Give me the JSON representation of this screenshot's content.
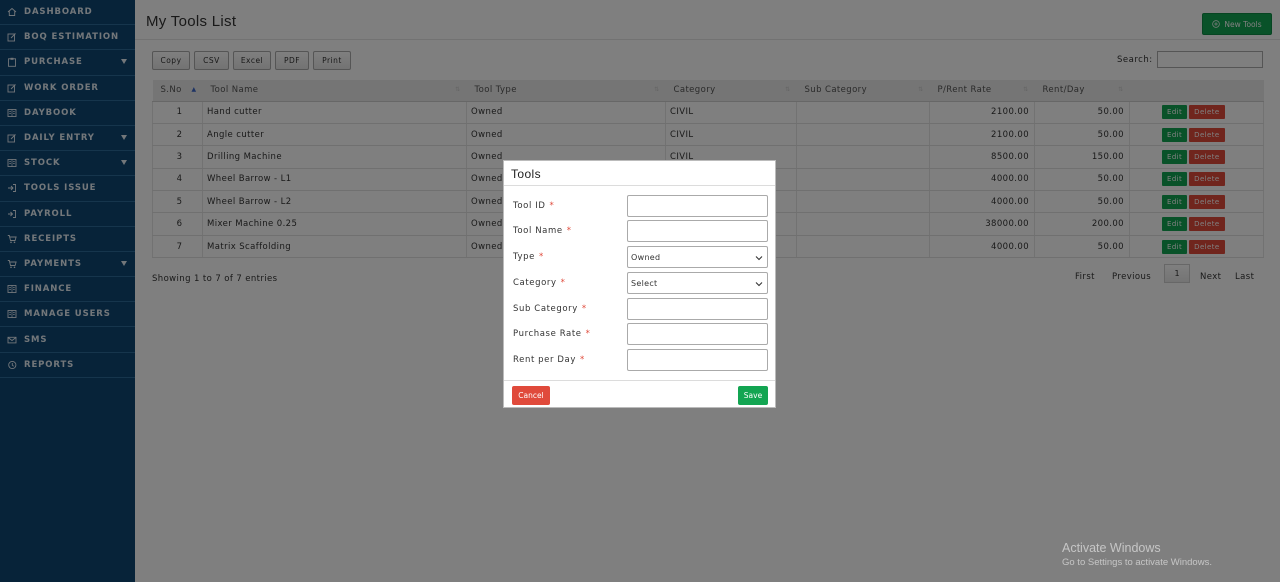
{
  "sidebar": {
    "items": [
      {
        "label": "DASHBOARD",
        "icon": "home-icon",
        "caret": false
      },
      {
        "label": "BOQ ESTIMATION",
        "icon": "edit-icon",
        "caret": false
      },
      {
        "label": "PURCHASE",
        "icon": "clipboard-icon",
        "caret": true
      },
      {
        "label": "WORK ORDER",
        "icon": "edit-icon",
        "caret": false
      },
      {
        "label": "DAYBOOK",
        "icon": "book-icon",
        "caret": false
      },
      {
        "label": "DAILY ENTRY",
        "icon": "edit-icon",
        "caret": true
      },
      {
        "label": "STOCK",
        "icon": "book-icon",
        "caret": true
      },
      {
        "label": "TOOLS ISSUE",
        "icon": "sign-out-icon",
        "caret": false
      },
      {
        "label": "PAYROLL",
        "icon": "sign-in-icon",
        "caret": false
      },
      {
        "label": "RECEIPTS",
        "icon": "cart-icon",
        "caret": false
      },
      {
        "label": "PAYMENTS",
        "icon": "cart-icon",
        "caret": true
      },
      {
        "label": "FINANCE",
        "icon": "book-icon",
        "caret": false
      },
      {
        "label": "MANAGE USERS",
        "icon": "book-icon",
        "caret": false
      },
      {
        "label": "SMS",
        "icon": "envelope-icon",
        "caret": false
      },
      {
        "label": "REPORTS",
        "icon": "history-icon",
        "caret": false
      }
    ]
  },
  "page": {
    "title": "My Tools List",
    "new_button": "New Tools"
  },
  "toolbar": {
    "copy": "Copy",
    "csv": "CSV",
    "excel": "Excel",
    "pdf": "PDF",
    "print": "Print",
    "search_label": "Search:",
    "search_value": ""
  },
  "table": {
    "headers": [
      "S.No",
      "Tool Name",
      "Tool Type",
      "Category",
      "Sub Category",
      "P/Rent Rate",
      "Rent/Day",
      ""
    ],
    "rows": [
      {
        "sno": "1",
        "name": "Hand cutter",
        "type": "Owned",
        "category": "CIVIL",
        "sub": "",
        "rate": "2100.00",
        "rent": "50.00"
      },
      {
        "sno": "2",
        "name": "Angle cutter",
        "type": "Owned",
        "category": "CIVIL",
        "sub": "",
        "rate": "2100.00",
        "rent": "50.00"
      },
      {
        "sno": "3",
        "name": "Drilling Machine",
        "type": "Owned",
        "category": "CIVIL",
        "sub": "",
        "rate": "8500.00",
        "rent": "150.00"
      },
      {
        "sno": "4",
        "name": "Wheel Barrow - L1",
        "type": "Owned",
        "category": "",
        "sub": "",
        "rate": "4000.00",
        "rent": "50.00"
      },
      {
        "sno": "5",
        "name": "Wheel Barrow - L2",
        "type": "Owned",
        "category": "",
        "sub": "",
        "rate": "4000.00",
        "rent": "50.00"
      },
      {
        "sno": "6",
        "name": "Mixer Machine 0.25",
        "type": "Owned",
        "category": "",
        "sub": "",
        "rate": "38000.00",
        "rent": "200.00"
      },
      {
        "sno": "7",
        "name": "Matrix Scaffolding",
        "type": "Owned",
        "category": "",
        "sub": "",
        "rate": "4000.00",
        "rent": "50.00"
      }
    ],
    "edit_label": "Edit",
    "delete_label": "Delete"
  },
  "footer": {
    "showing": "Showing 1 to 7 of 7 entries",
    "first": "First",
    "previous": "Previous",
    "page": "1",
    "next": "Next",
    "last": "Last"
  },
  "modal": {
    "title": "Tools",
    "fields": {
      "tool_id": {
        "label": "Tool ID",
        "value": ""
      },
      "tool_name": {
        "label": "Tool Name",
        "value": ""
      },
      "type": {
        "label": "Type",
        "value": "Owned"
      },
      "category": {
        "label": "Category",
        "value": "Select"
      },
      "sub_category": {
        "label": "Sub Category",
        "value": ""
      },
      "purchase_rate": {
        "label": "Purchase Rate",
        "value": ""
      },
      "rent_per_day": {
        "label": "Rent per Day",
        "value": ""
      }
    },
    "required_mark": "*",
    "cancel": "Cancel",
    "save": "Save"
  },
  "watermark": {
    "line1": "Activate Windows",
    "line2": "Go to Settings to activate Windows."
  },
  "colors": {
    "sidebar": "#0f4773",
    "primary_green": "#13a552",
    "danger_red": "#e04a3b"
  }
}
